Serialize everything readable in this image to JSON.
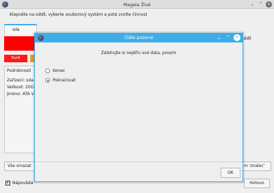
{
  "window": {
    "title": "Mageia Živé",
    "app_icon": "mageia-logo-icon",
    "controls": [
      "chevron-down-icon",
      "chevron-up-icon",
      "close-icon"
    ]
  },
  "instruction": "Klepněte na oddíl, vyberte souborový systém a poté zvolte činnost",
  "disk_tabs": [
    {
      "label": "sda",
      "active": true
    }
  ],
  "partition_bar": {
    "color": "#ff0000",
    "right_label": "oddíl"
  },
  "action_buttons": {
    "red_label": "Ext4",
    "red_color": "#ff1a1a",
    "orange_color": "#e69a2e"
  },
  "details": {
    "heading": "Podrobnosti",
    "lines": [
      "Zařízení: sda",
      "Velikost: 20G",
      "Jméno: ATA V"
    ]
  },
  "bottom_buttons": {
    "clear_all": "Vše smazat",
    "expert_mode": "m 'znalec'",
    "help": "Nápověda",
    "done": "Hotovo"
  },
  "dialog": {
    "title": "Čtěte pozorně",
    "message": "Zálohujte si nejdřív svá data, prosím",
    "options": [
      {
        "label": "Konec",
        "selected": false
      },
      {
        "label": "Pokračovat",
        "selected": true
      }
    ],
    "ok_label": "OK",
    "accent_color": "#3daee9"
  }
}
